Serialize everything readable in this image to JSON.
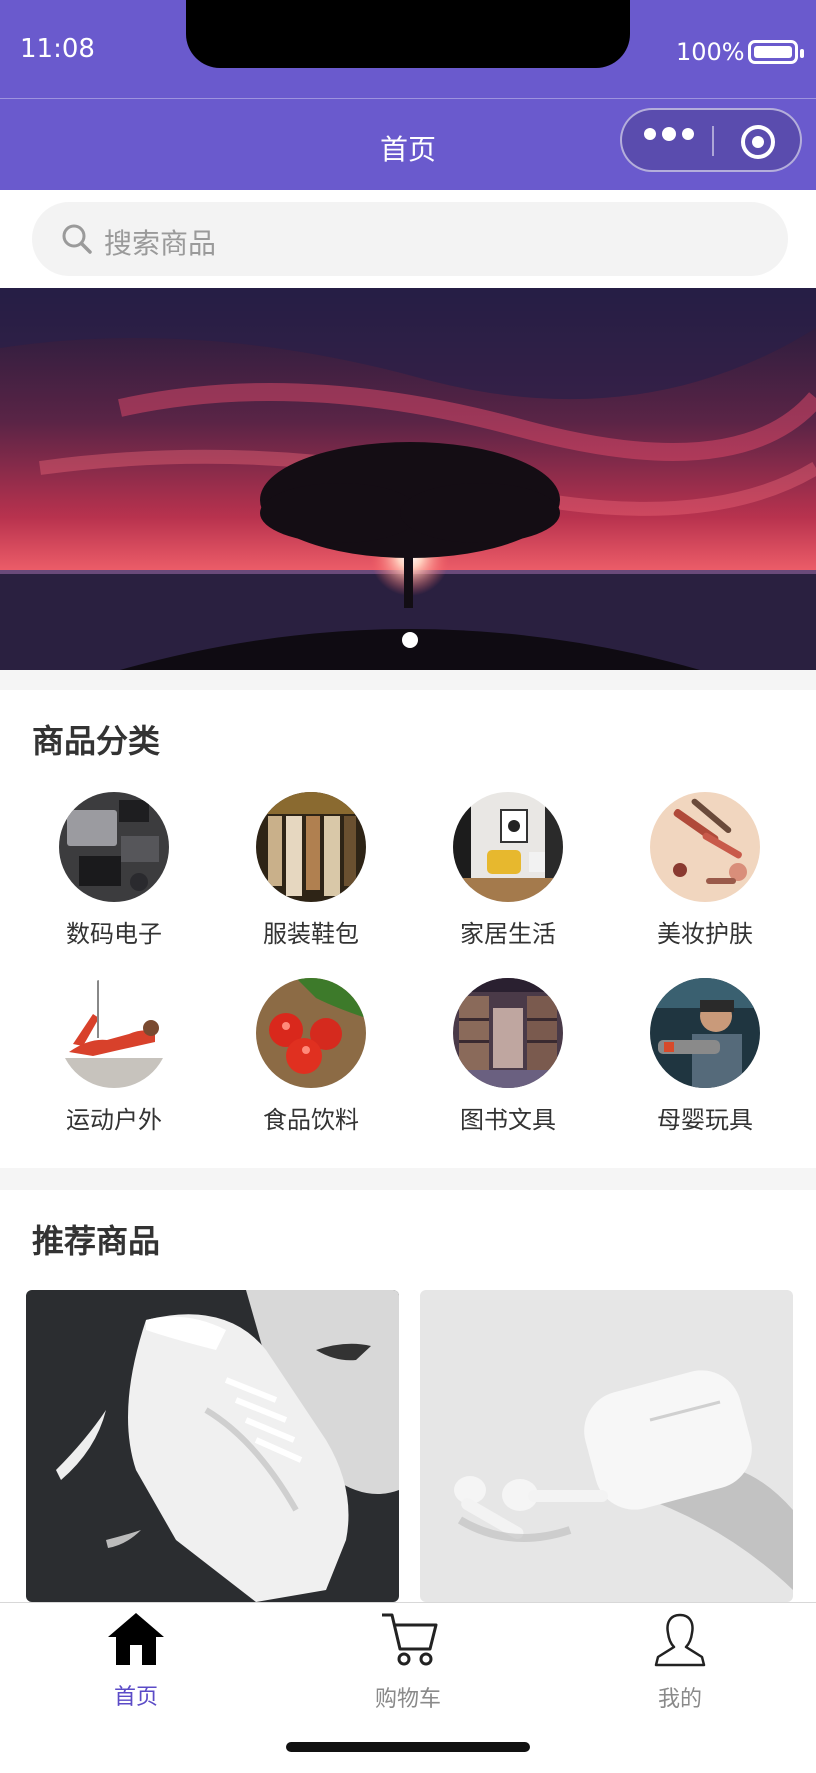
{
  "status_bar": {
    "time": "11:08",
    "battery": "100%"
  },
  "nav": {
    "title": "首页"
  },
  "search": {
    "placeholder": "搜索商品"
  },
  "categories": {
    "title": "商品分类",
    "items": [
      {
        "label": "数码电子",
        "icon": "digital-electronics-image"
      },
      {
        "label": "服装鞋包",
        "icon": "clothing-image"
      },
      {
        "label": "家居生活",
        "icon": "home-living-image"
      },
      {
        "label": "美妆护肤",
        "icon": "beauty-image"
      },
      {
        "label": "运动户外",
        "icon": "sports-image"
      },
      {
        "label": "食品饮料",
        "icon": "food-image"
      },
      {
        "label": "图书文具",
        "icon": "books-image"
      },
      {
        "label": "母婴玩具",
        "icon": "baby-toys-image"
      }
    ]
  },
  "recommend": {
    "title": "推荐商品"
  },
  "tabbar": {
    "items": [
      {
        "label": "首页",
        "icon": "home-icon",
        "active": true
      },
      {
        "label": "购物车",
        "icon": "cart-icon",
        "active": false
      },
      {
        "label": "我的",
        "icon": "user-icon",
        "active": false
      }
    ]
  },
  "colors": {
    "primary": "#6a5acd",
    "active_tab": "#5b4bc7",
    "inactive_tab": "#8a8a8a"
  }
}
